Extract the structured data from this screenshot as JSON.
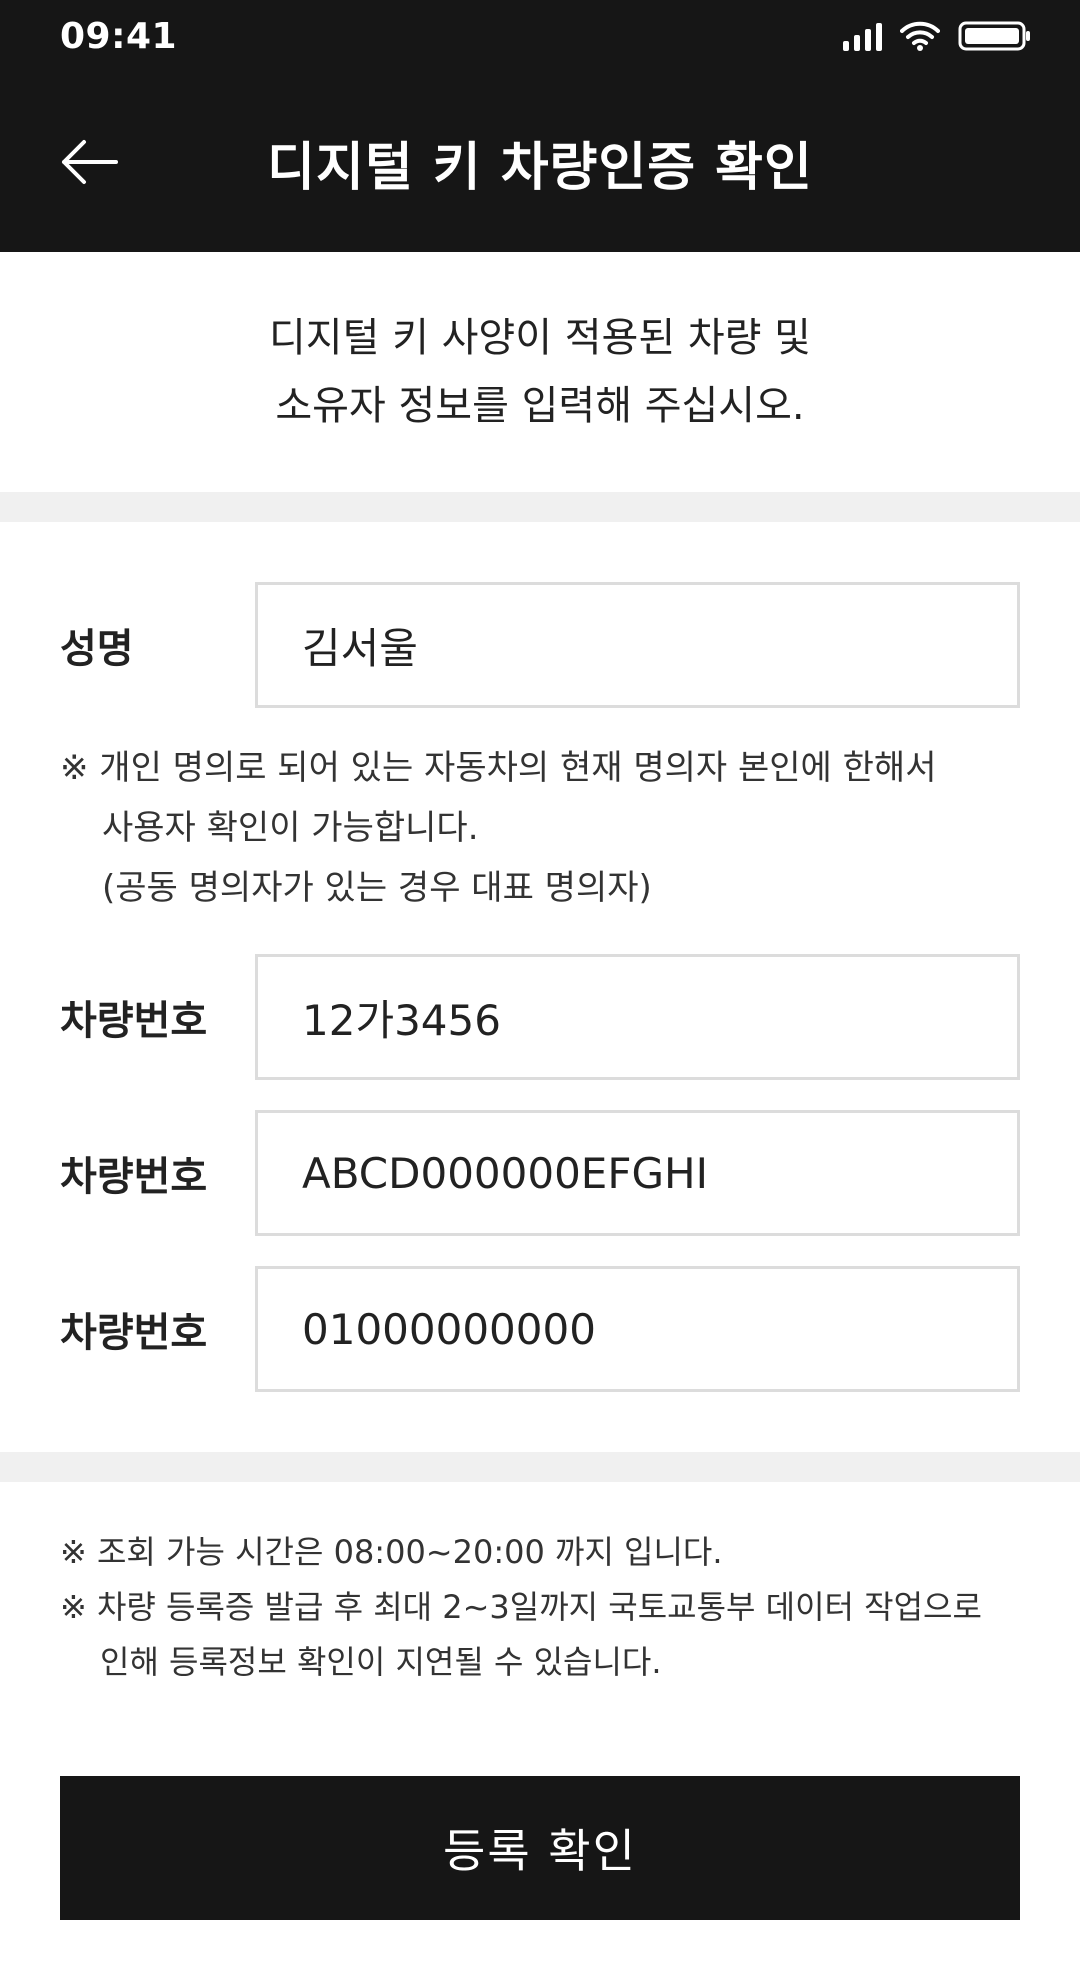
{
  "status_bar": {
    "time": "09:41"
  },
  "header": {
    "title": "디지털 키 차량인증 확인"
  },
  "intro": {
    "line1": "디지털 키 사양이 적용된 차량 및",
    "line2": "소유자 정보를 입력해 주십시오."
  },
  "form": {
    "name": {
      "label": "성명",
      "value": "김서울"
    },
    "owner_note": {
      "line1": "※ 개인 명의로 되어 있는 자동차의 현재 명의자 본인에 한해서",
      "line2": "사용자 확인이 가능합니다.",
      "line3": "(공동 명의자가 있는 경우 대표 명의자)"
    },
    "plate": {
      "label": "차량번호",
      "value": "12가3456"
    },
    "vin": {
      "label": "차량번호",
      "value": "ABCD000000EFGHI"
    },
    "phone": {
      "label": "차량번호",
      "value": "01000000000"
    }
  },
  "notes": {
    "line1": "※ 조회 가능 시간은 08:00~20:00 까지 입니다.",
    "line2": "※ 차량 등록증 발급 후 최대 2~3일까지 국토교통부 데이터 작업으로",
    "line3": "인해 등록정보 확인이 지연될 수 있습니다."
  },
  "actions": {
    "confirm_label": "등록 확인"
  },
  "colors": {
    "header_bg": "#161616",
    "divider": "#f0f0f0",
    "input_border": "#dcdcdc"
  }
}
